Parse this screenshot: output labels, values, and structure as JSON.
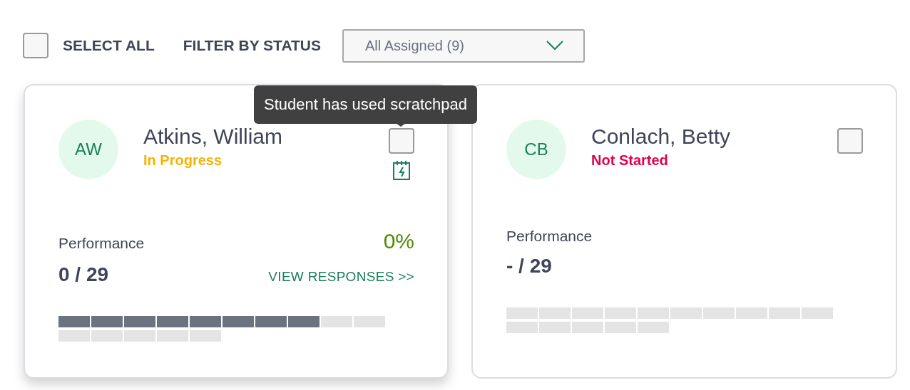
{
  "toolbar": {
    "select_all": {
      "label": "SELECT ALL",
      "checked": false
    },
    "filter_label": "FILTER BY STATUS",
    "filter_dropdown": {
      "value": "All Assigned (9)"
    }
  },
  "tooltip": {
    "text": "Student has used scratchpad"
  },
  "students": [
    {
      "initials": "AW",
      "name": "Atkins, William",
      "status": {
        "text": "In Progress",
        "kind": "in_progress"
      },
      "selected": false,
      "hovered": true,
      "scratchpad_used": true,
      "performance_label": "Performance",
      "percent": "0%",
      "score": "0 / 29",
      "link": "VIEW RESPONSES >>",
      "segments": [
        {
          "done": true
        },
        {
          "done": true
        },
        {
          "done": true
        },
        {
          "done": true
        },
        {
          "done": true
        },
        {
          "done": true
        },
        {
          "done": true
        },
        {
          "done": true
        },
        {
          "done": false
        },
        {
          "done": false
        },
        {
          "done": false
        },
        {
          "done": false
        },
        {
          "done": false
        },
        {
          "done": false
        },
        {
          "done": false
        }
      ]
    },
    {
      "initials": "CB",
      "name": "Conlach, Betty",
      "status": {
        "text": "Not Started",
        "kind": "not_started"
      },
      "selected": false,
      "hovered": false,
      "scratchpad_used": false,
      "performance_label": "Performance",
      "score": "- / 29",
      "segments": [
        {
          "done": false
        },
        {
          "done": false
        },
        {
          "done": false
        },
        {
          "done": false
        },
        {
          "done": false
        },
        {
          "done": false
        },
        {
          "done": false
        },
        {
          "done": false
        },
        {
          "done": false
        },
        {
          "done": false
        },
        {
          "done": false
        },
        {
          "done": false
        },
        {
          "done": false
        },
        {
          "done": false
        },
        {
          "done": false
        }
      ]
    }
  ]
}
